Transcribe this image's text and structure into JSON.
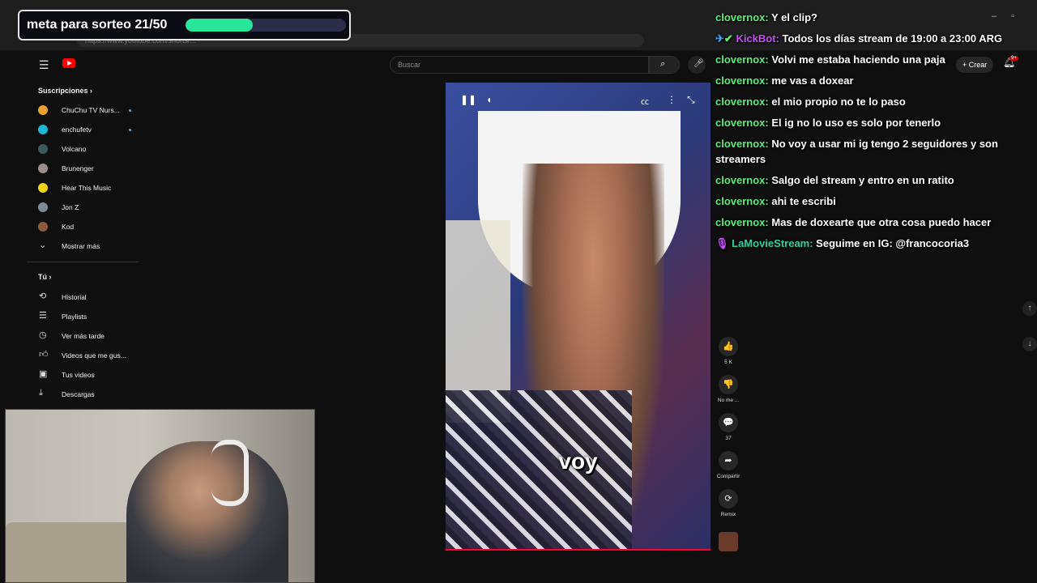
{
  "browser": {
    "url": "https://www.youtube.com/shorts/..."
  },
  "goal_widget": {
    "label": "meta para sorteo 21/50",
    "current": 21,
    "target": 50,
    "fill_color": "#27e69a"
  },
  "youtube": {
    "search_placeholder": "Buscar",
    "create_label": "Crear",
    "notification_badge": "9+",
    "sidebar": {
      "subscriptions_heading": "Suscripciones",
      "subscriptions": [
        {
          "label": "ChuChu TV Nurs...",
          "avatar_color": "#e9a22f",
          "live": true
        },
        {
          "label": "enchufetv",
          "avatar_color": "#1fb6d4",
          "live": true
        },
        {
          "label": "Volcano",
          "avatar_color": "#3c5a5a",
          "live": false
        },
        {
          "label": "Brunenger",
          "avatar_color": "#9b8f8a",
          "live": false
        },
        {
          "label": "Hear This Music",
          "avatar_color": "#f2d21a",
          "live": false
        },
        {
          "label": "Jon Z",
          "avatar_color": "#7d8b97",
          "live": false
        },
        {
          "label": "Kod",
          "avatar_color": "#8b5a3c",
          "live": false
        }
      ],
      "show_more_label": "Mostrar más",
      "you_heading": "Tú",
      "you_items": [
        {
          "label": "Historial",
          "icon": "history-icon"
        },
        {
          "label": "Playlists",
          "icon": "playlist-icon"
        },
        {
          "label": "Ver más tarde",
          "icon": "clock-icon"
        },
        {
          "label": "Videos que me gus...",
          "icon": "like-icon"
        },
        {
          "label": "Tus videos",
          "icon": "video-icon"
        },
        {
          "label": "Descargas",
          "icon": "download-icon"
        }
      ]
    },
    "video": {
      "caption": "voy"
    },
    "actions": [
      {
        "name": "like",
        "count": "5 K",
        "icon": "thumbs-up-icon",
        "glyph": "👍"
      },
      {
        "name": "dislike",
        "count": "No me ...",
        "icon": "thumbs-down-icon",
        "glyph": "👎"
      },
      {
        "name": "comments",
        "count": "37",
        "icon": "comment-icon",
        "glyph": "💬"
      },
      {
        "name": "share",
        "count": "Compartir",
        "icon": "share-icon",
        "glyph": "➦"
      },
      {
        "name": "remix",
        "count": "Remix",
        "icon": "remix-icon",
        "glyph": "⟳"
      }
    ]
  },
  "chat": {
    "messages": [
      {
        "user": "clovernox:",
        "text": " Y el clip?"
      },
      {
        "user": "KickBot:",
        "text": " Todos los días stream de 19:00 a 23:00 ARG"
      },
      {
        "user": "clovernox:",
        "text": " Volvi me estaba haciendo una paja"
      },
      {
        "user": "clovernox:",
        "text": " me vas a doxear"
      },
      {
        "user": "clovernox:",
        "text": " el mio propio no te lo paso"
      },
      {
        "user": "clovernox:",
        "text": " El ig no lo uso es solo por tenerlo"
      },
      {
        "user": "clovernox:",
        "text": " No voy a usar mi ig tengo 2 seguidores y son streamers"
      },
      {
        "user": "clovernox:",
        "text": " Salgo del stream y entro en un ratito"
      },
      {
        "user": "clovernox:",
        "text": " ahi te escribi"
      },
      {
        "user": "clovernox:",
        "text": " Mas de doxearte que otra cosa puedo hacer"
      },
      {
        "user": "LaMovieStream:",
        "text": " Seguime en IG: @francocoria3"
      }
    ]
  }
}
